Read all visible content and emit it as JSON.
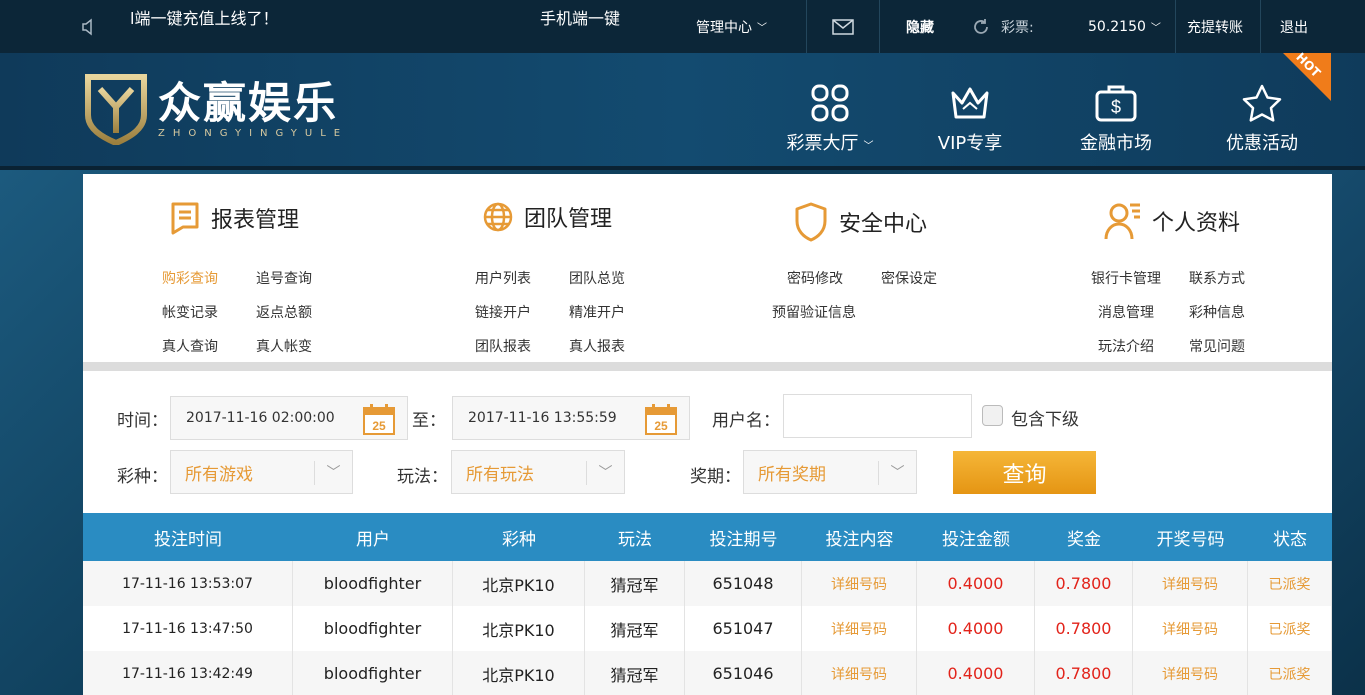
{
  "topbar": {
    "notice1": "l端一键充值上线了！",
    "notice2": "手机端一键",
    "manage": "管理中心",
    "hide": "隐藏",
    "lottery_label": "彩票:",
    "balance": "50.2150",
    "transfer": "充提转账",
    "logout": "退出"
  },
  "header": {
    "logo_title": "众赢娱乐",
    "logo_sub": "ZHONGYINGYULE",
    "nav": [
      {
        "label": "彩票大厅",
        "icon": "grid-icon"
      },
      {
        "label": "VIP专享",
        "icon": "crown-icon"
      },
      {
        "label": "金融市场",
        "icon": "money-bag-icon"
      },
      {
        "label": "优惠活动",
        "icon": "star-icon"
      }
    ],
    "hot": "HOT"
  },
  "categories": [
    {
      "title": "报表管理",
      "links": [
        "购彩查询",
        "追号查询",
        "帐变记录",
        "返点总额",
        "真人查询",
        "真人帐变"
      ]
    },
    {
      "title": "团队管理",
      "links": [
        "用户列表",
        "团队总览",
        "链接开户",
        "精准开户",
        "团队报表",
        "真人报表"
      ]
    },
    {
      "title": "安全中心",
      "links": [
        "密码修改",
        "密保设定",
        "预留验证信息"
      ]
    },
    {
      "title": "个人资料",
      "links": [
        "银行卡管理",
        "联系方式",
        "消息管理",
        "彩种信息",
        "玩法介绍",
        "常见问题"
      ]
    }
  ],
  "filters": {
    "time_label": "时间：",
    "time_start": "2017-11-16 02:00:00",
    "to_label": "至：",
    "time_end": "2017-11-16 13:55:59",
    "cal_day": "25",
    "username_label": "用户名：",
    "username_value": "",
    "include_sub": "包含下级",
    "lottery_label": "彩种：",
    "lottery_value": "所有游戏",
    "play_label": "玩法：",
    "play_value": "所有玩法",
    "prize_label": "奖期：",
    "prize_value": "所有奖期",
    "query_button": "查询"
  },
  "table": {
    "columns": [
      "投注时间",
      "用户",
      "彩种",
      "玩法",
      "投注期号",
      "投注内容",
      "投注金额",
      "奖金",
      "开奖号码",
      "状态"
    ],
    "rows": [
      [
        "17-11-16 13:53:07",
        "bloodfighter",
        "北京PK10",
        "猜冠军",
        "651048",
        "详细号码",
        "0.4000",
        "0.7800",
        "详细号码",
        "已派奖"
      ],
      [
        "17-11-16 13:47:50",
        "bloodfighter",
        "北京PK10",
        "猜冠军",
        "651047",
        "详细号码",
        "0.4000",
        "0.7800",
        "详细号码",
        "已派奖"
      ],
      [
        "17-11-16 13:42:49",
        "bloodfighter",
        "北京PK10",
        "猜冠军",
        "651046",
        "详细号码",
        "0.4000",
        "0.7800",
        "详细号码",
        "已派奖"
      ]
    ]
  },
  "colors": {
    "accent": "#e69a36",
    "header_bg": "#2a8cc2",
    "money": "#e2231a",
    "topbar": "#0c2638"
  }
}
